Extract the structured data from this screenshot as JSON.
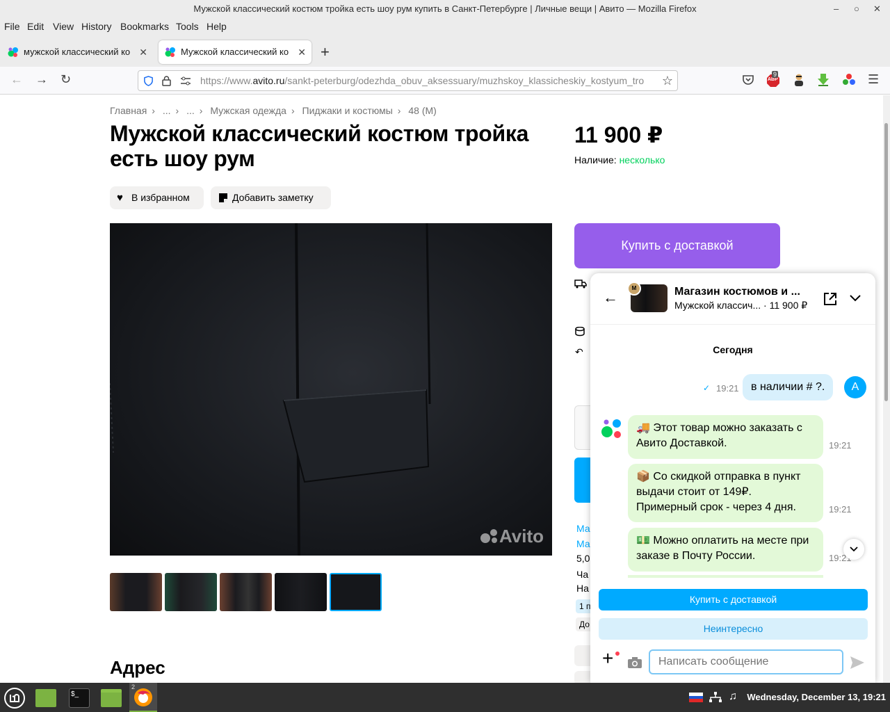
{
  "window": {
    "title": "Мужской классический костюм тройка есть шоу рум купить в Санкт-Петербурге | Личные вещи | Авито — Mozilla Firefox"
  },
  "menu": [
    "File",
    "Edit",
    "View",
    "History",
    "Bookmarks",
    "Tools",
    "Help"
  ],
  "tabs": [
    {
      "label": "мужской классический ко"
    },
    {
      "label": "Мужской классический ко"
    }
  ],
  "url": {
    "prefix": "https://www.",
    "domain": "avito.ru",
    "path": "/sankt-peterburg/odezhda_obuv_aksessuary/muzhskoy_klassicheskiy_kostyum_tro"
  },
  "extensions": {
    "abp_badge": "9",
    "abp_label": "ABP"
  },
  "breadcrumbs": [
    "Главная",
    "...",
    "...",
    "Мужская одежда",
    "Пиджаки и костюмы",
    "48 (M)"
  ],
  "product": {
    "title": "Мужской классический костюм тройка есть шоу рум",
    "price": "11 900 ₽",
    "avail_label": "Наличие:",
    "avail_value": "несколько",
    "favorite_label": "В избранном",
    "note_label": "Добавить заметку",
    "buy_label": "Купить с доставкой",
    "watermark": "Avito",
    "address_heading": "Адрес"
  },
  "sidebar_fragments": [
    "Ма",
    "Ма",
    "5,0",
    "Ча",
    "На",
    "1 п",
    "До"
  ],
  "chat": {
    "shop_name": "Магазин костюмов и ...",
    "item_name": "Мужской классич...",
    "item_price": "· 11 900 ₽",
    "date_label": "Сегодня",
    "outgoing": {
      "text": "в наличии  # ?.",
      "time": "19:21",
      "avatar_letter": "A"
    },
    "incoming": [
      {
        "text": "🚚 Этот товар можно заказать с Авито Доставкой.",
        "time": "19:21"
      },
      {
        "text": "📦 Со скидкой отправка в пункт выдачи стоит от 149₽. Примерный срок - через 4 дня.",
        "time": "19:21"
      },
      {
        "text": "💵 Можно оплатить на месте при заказе в Почту России.",
        "time": "19:21"
      }
    ],
    "buy_button": "Купить с доставкой",
    "not_interested_button": "Неинтересно",
    "input_placeholder": "Написать сообщение"
  },
  "taskbar": {
    "clock": "Wednesday, December 13, 19:21",
    "window_count": "2"
  },
  "colors": {
    "buy_purple": "#965eeb",
    "chat_blue": "#00aaff",
    "avail_green": "#02d15c",
    "bubble_green": "#e3f9d8",
    "bubble_blue": "#d8f0fc"
  }
}
